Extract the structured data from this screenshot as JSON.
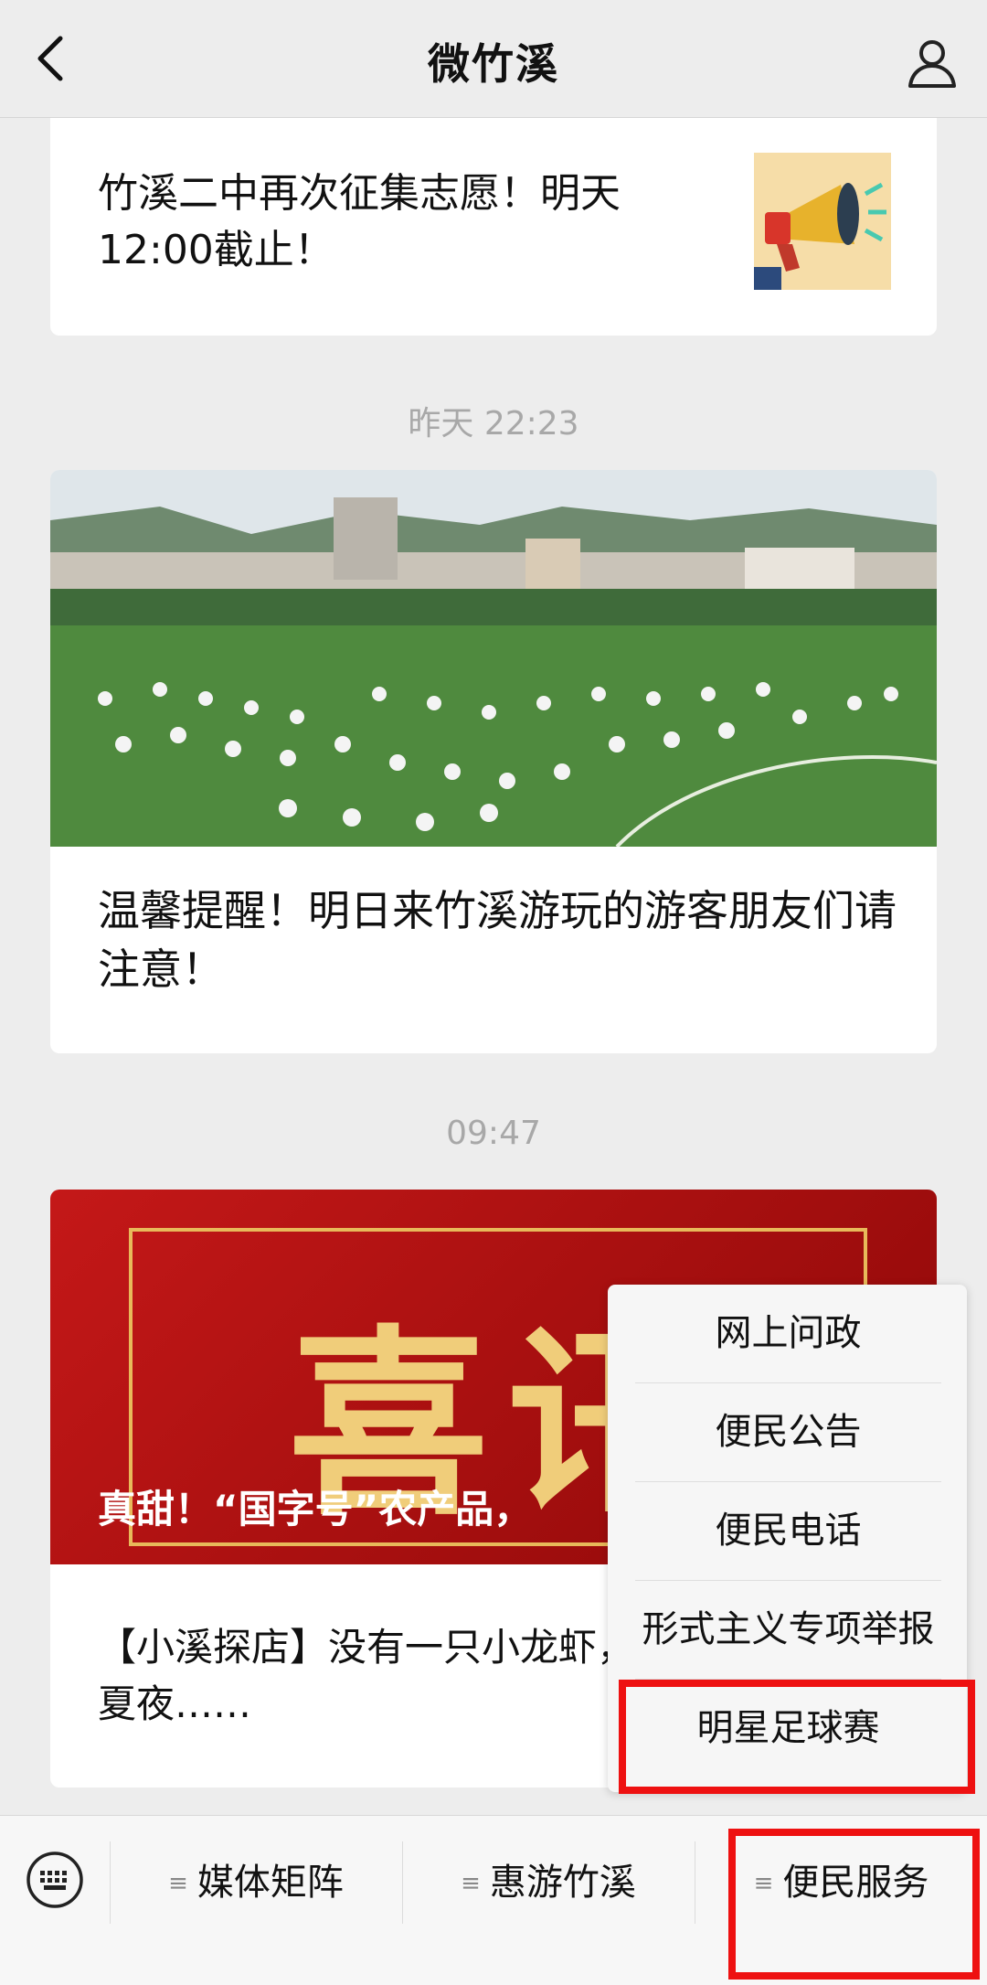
{
  "header": {
    "title": "微竹溪"
  },
  "feed": {
    "articles": [
      {
        "title": "竹溪二中再次征集志愿！明天12:00截止！"
      },
      {
        "time": "昨天 22:23",
        "title": "温馨提醒！明日来竹溪游玩的游客朋友们请注意！"
      },
      {
        "time": "09:47",
        "cover_headline": "真甜！“国字号”农产品，",
        "cover_big_text": "喜讯",
        "title": "【小溪探店】没有一只小龙虾，整地走出溪城夏夜……"
      }
    ]
  },
  "popup_menu": {
    "items": [
      "网上问政",
      "便民公告",
      "便民电话",
      "形式主义专项举报",
      "明星足球赛"
    ]
  },
  "bottom_menu": {
    "tabs": [
      "媒体矩阵",
      "惠游竹溪",
      "便民服务"
    ],
    "tab_icon": "≡"
  },
  "colors": {
    "highlight": "#ee1111",
    "background": "#ededed"
  }
}
